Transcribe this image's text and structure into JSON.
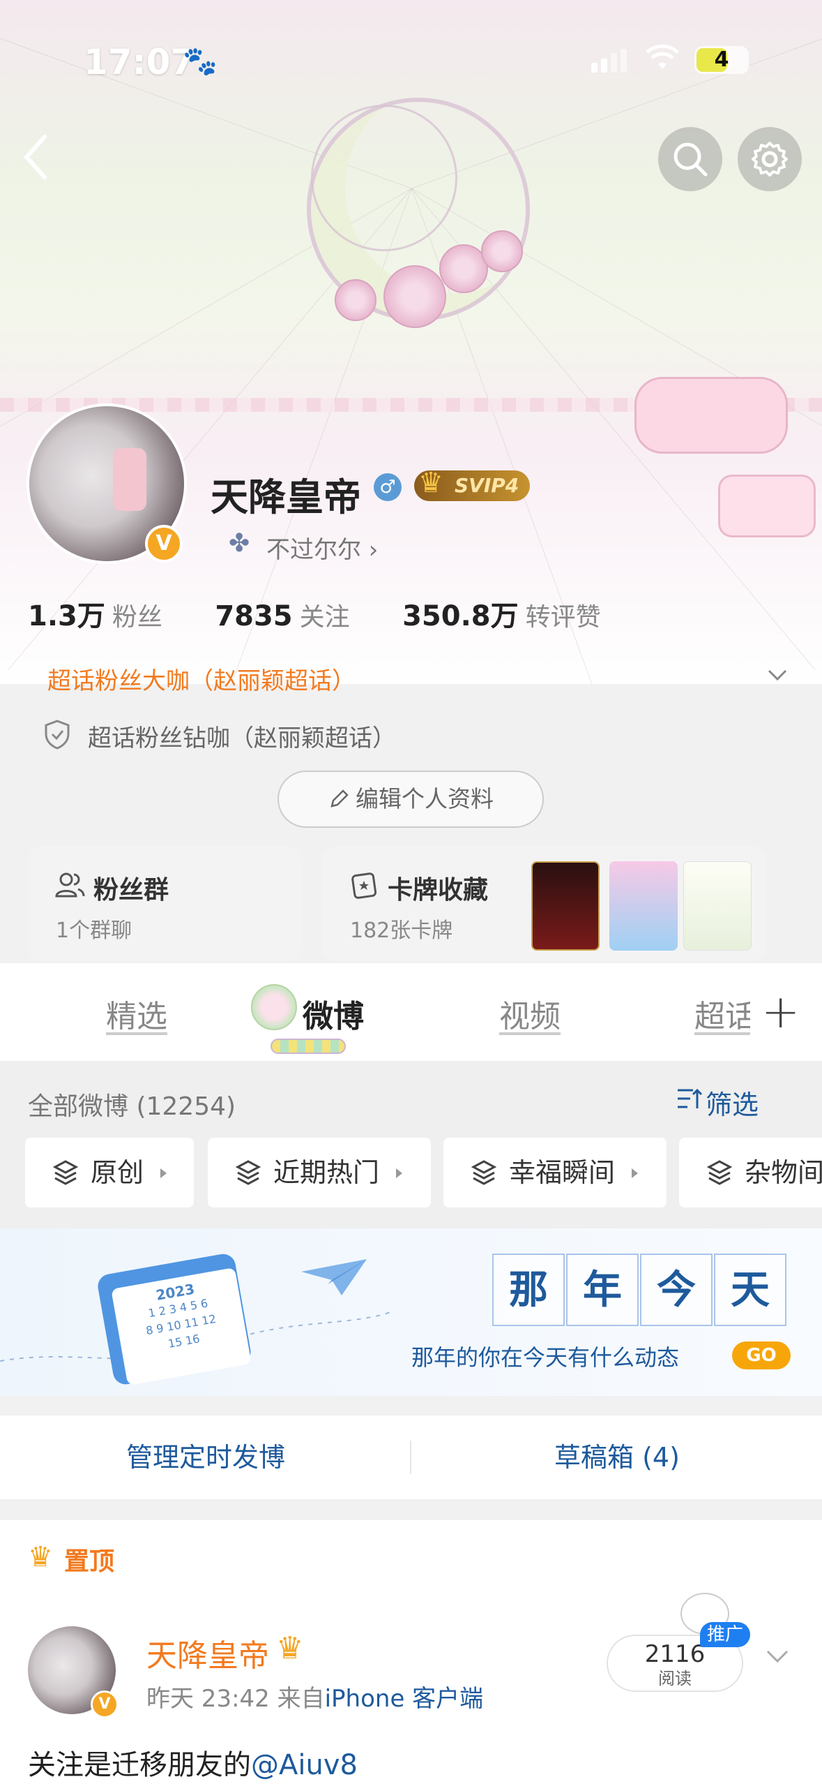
{
  "status_bar": {
    "time": "17:07",
    "battery": "4"
  },
  "profile": {
    "username": "天降皇帝",
    "svip": "SVIP4",
    "subname": "不过尔尔",
    "stats": [
      {
        "num": "1.3万",
        "label": "粉丝"
      },
      {
        "num": "7835",
        "label": "关注"
      },
      {
        "num": "350.8万",
        "label": "转评赞"
      }
    ],
    "superfan_title": "超话粉丝大咖（赵丽颖超话）",
    "superfan_title2": "超话粉丝钻咖（赵丽颖超话）",
    "edit_label": "编辑个人资料"
  },
  "cards": {
    "fans_group": {
      "title": "粉丝群",
      "sub": "1个群聊"
    },
    "card_collection": {
      "title": "卡牌收藏",
      "sub": "182张卡牌"
    }
  },
  "tabs": [
    "精选",
    "微博",
    "视频",
    "超话"
  ],
  "feed_header": {
    "all_label": "全部微博 (12254)",
    "filter_label": "筛选",
    "chips": [
      "原创",
      "近期热门",
      "幸福瞬间",
      "杂物间"
    ]
  },
  "memory": {
    "chars": [
      "那",
      "年",
      "今",
      "天"
    ],
    "subtitle": "那年的你在今天有什么动态",
    "go": "GO",
    "calendar_year": "2023",
    "calendar_rows": [
      "1 2 3 4 5 6",
      "8 9 10 11 12",
      "15 16"
    ]
  },
  "manage": {
    "scheduled": "管理定时发博",
    "drafts": "草稿箱 (4)"
  },
  "post": {
    "pinned_label": "置顶",
    "author": "天降皇帝",
    "time": "昨天 23:42",
    "from_label": "来自",
    "source": "iPhone 客户端",
    "reads_num": "2116",
    "reads_label": "阅读",
    "promo": "推广",
    "text": "关注是迁移朋友的",
    "mention": "@Aiuv8"
  },
  "colors": {
    "accent_orange": "#f27a1f",
    "link_blue": "#1e5a9c",
    "gold": "#f5a623"
  }
}
